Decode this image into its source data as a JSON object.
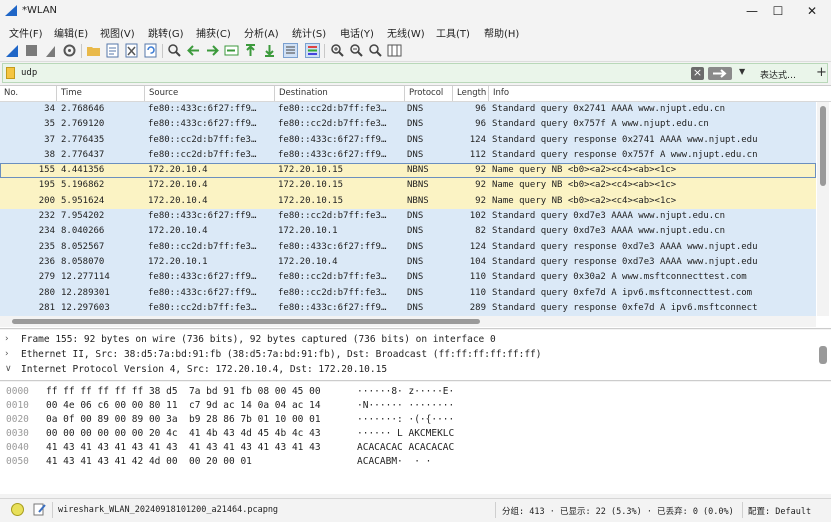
{
  "window": {
    "title": "*WLAN",
    "controls": [
      "—",
      "☐",
      "✕"
    ]
  },
  "menu": [
    "文件(F)",
    "编辑(E)",
    "视图(V)",
    "跳转(G)",
    "捕获(C)",
    "分析(A)",
    "统计(S)",
    "电话(Y)",
    "无线(W)",
    "工具(T)",
    "帮助(H)"
  ],
  "toolbar_icons": [
    "shark-fin-start-icon",
    "stop-icon",
    "restart-icon",
    "options-gear-icon",
    "open-folder-icon",
    "save-file-icon",
    "close-file-icon",
    "reload-icon",
    "find-icon",
    "go-back-icon",
    "go-forward-icon",
    "go-to-packet-icon",
    "first-packet-icon",
    "last-packet-icon",
    "autoscroll-icon",
    "colorize-icon",
    "zoom-in-icon",
    "zoom-out-icon",
    "normal-size-icon",
    "resize-columns-icon"
  ],
  "filter": {
    "value": "udp",
    "expression_label": "表达式…",
    "add_label": "+"
  },
  "columns": [
    "No.",
    "Time",
    "Source",
    "Destination",
    "Protocol",
    "Length",
    "Info"
  ],
  "packets": [
    {
      "no": "34",
      "time": "2.768646",
      "src": "fe80::433c:6f27:ff9…",
      "dst": "fe80::cc2d:b7ff:fe3…",
      "proto": "DNS",
      "len": "96",
      "info": "Standard query 0x2741 AAAA www.njupt.edu.cn",
      "color": "blue",
      "selected": false
    },
    {
      "no": "35",
      "time": "2.769120",
      "src": "fe80::433c:6f27:ff9…",
      "dst": "fe80::cc2d:b7ff:fe3…",
      "proto": "DNS",
      "len": "96",
      "info": "Standard query 0x757f A www.njupt.edu.cn",
      "color": "blue",
      "selected": false
    },
    {
      "no": "37",
      "time": "2.776435",
      "src": "fe80::cc2d:b7ff:fe3…",
      "dst": "fe80::433c:6f27:ff9…",
      "proto": "DNS",
      "len": "124",
      "info": "Standard query response 0x2741 AAAA www.njupt.edu",
      "color": "blue",
      "selected": false
    },
    {
      "no": "38",
      "time": "2.776437",
      "src": "fe80::cc2d:b7ff:fe3…",
      "dst": "fe80::433c:6f27:ff9…",
      "proto": "DNS",
      "len": "112",
      "info": "Standard query response 0x757f A www.njupt.edu.cn",
      "color": "blue",
      "selected": false
    },
    {
      "no": "155",
      "time": "4.441356",
      "src": "172.20.10.4",
      "dst": "172.20.10.15",
      "proto": "NBNS",
      "len": "92",
      "info": "Name query NB <b0><a2><c4><ab><1c>",
      "color": "yellow",
      "selected": true
    },
    {
      "no": "195",
      "time": "5.196862",
      "src": "172.20.10.4",
      "dst": "172.20.10.15",
      "proto": "NBNS",
      "len": "92",
      "info": "Name query NB <b0><a2><c4><ab><1c>",
      "color": "yellow",
      "selected": false
    },
    {
      "no": "200",
      "time": "5.951624",
      "src": "172.20.10.4",
      "dst": "172.20.10.15",
      "proto": "NBNS",
      "len": "92",
      "info": "Name query NB <b0><a2><c4><ab><1c>",
      "color": "yellow",
      "selected": false
    },
    {
      "no": "232",
      "time": "7.954202",
      "src": "fe80::433c:6f27:ff9…",
      "dst": "fe80::cc2d:b7ff:fe3…",
      "proto": "DNS",
      "len": "102",
      "info": "Standard query 0xd7e3 AAAA www.njupt.edu.cn",
      "color": "blue",
      "selected": false
    },
    {
      "no": "234",
      "time": "8.040266",
      "src": "172.20.10.4",
      "dst": "172.20.10.1",
      "proto": "DNS",
      "len": "82",
      "info": "Standard query 0xd7e3 AAAA www.njupt.edu.cn",
      "color": "blue",
      "selected": false
    },
    {
      "no": "235",
      "time": "8.052567",
      "src": "fe80::cc2d:b7ff:fe3…",
      "dst": "fe80::433c:6f27:ff9…",
      "proto": "DNS",
      "len": "124",
      "info": "Standard query response 0xd7e3 AAAA www.njupt.edu",
      "color": "blue",
      "selected": false
    },
    {
      "no": "236",
      "time": "8.058070",
      "src": "172.20.10.1",
      "dst": "172.20.10.4",
      "proto": "DNS",
      "len": "104",
      "info": "Standard query response 0xd7e3 AAAA www.njupt.edu",
      "color": "blue",
      "selected": false
    },
    {
      "no": "279",
      "time": "12.277114",
      "src": "fe80::433c:6f27:ff9…",
      "dst": "fe80::cc2d:b7ff:fe3…",
      "proto": "DNS",
      "len": "110",
      "info": "Standard query 0x30a2 A www.msftconnecttest.com",
      "color": "blue",
      "selected": false
    },
    {
      "no": "280",
      "time": "12.289301",
      "src": "fe80::433c:6f27:ff9…",
      "dst": "fe80::cc2d:b7ff:fe3…",
      "proto": "DNS",
      "len": "110",
      "info": "Standard query 0xfe7d A ipv6.msftconnecttest.com",
      "color": "blue",
      "selected": false
    },
    {
      "no": "281",
      "time": "12.297603",
      "src": "fe80::cc2d:b7ff:fe3…",
      "dst": "fe80::433c:6f27:ff9…",
      "proto": "DNS",
      "len": "289",
      "info": "Standard query response 0xfe7d A ipv6.msftconnect",
      "color": "blue",
      "selected": false
    }
  ],
  "details": [
    {
      "arrow": "›",
      "text": "Frame 155: 92 bytes on wire (736 bits), 92 bytes captured (736 bits) on interface 0"
    },
    {
      "arrow": "›",
      "text": "Ethernet II, Src: 38:d5:7a:bd:91:fb (38:d5:7a:bd:91:fb), Dst: Broadcast (ff:ff:ff:ff:ff:ff)"
    },
    {
      "arrow": "∨",
      "text": "Internet Protocol Version 4, Src: 172.20.10.4, Dst: 172.20.10.15"
    }
  ],
  "hex": [
    {
      "off": "0000",
      "bytes": "ff ff ff ff ff ff 38 d5  7a bd 91 fb 08 00 45 00",
      "ascii": "······8· z·····E·"
    },
    {
      "off": "0010",
      "bytes": "00 4e 06 c6 00 00 80 11  c7 9d ac 14 0a 04 ac 14",
      "ascii": "·N······ ········"
    },
    {
      "off": "0020",
      "bytes": "0a 0f 00 89 00 89 00 3a  b9 28 86 7b 01 10 00 01",
      "ascii": "·······: ·(·{····"
    },
    {
      "off": "0030",
      "bytes": "00 00 00 00 00 00 20 4c  41 4b 43 4d 45 4b 4c 43",
      "ascii": "······ L AKCMEKLC"
    },
    {
      "off": "0040",
      "bytes": "41 43 41 43 41 43 41 43  41 43 41 43 41 43 41 43",
      "ascii": "ACACACAC ACACACAC"
    },
    {
      "off": "0050",
      "bytes": "41 43 41 43 41 42 4d 00  00 20 00 01",
      "ascii": "ACACABM·  · ·"
    }
  ],
  "status": {
    "file": "wireshark_WLAN_20240918101200_a21464.pcapng",
    "stats": "分组: 413 · 已显示: 22 (5.3%) · 已丢弃: 0 (0.0%)",
    "profile": "配置: Default"
  },
  "colors": {
    "dns_row": "#dbe9f7",
    "nbns_row": "#fbf3c4",
    "filter_ok": "#eaf5ea"
  }
}
